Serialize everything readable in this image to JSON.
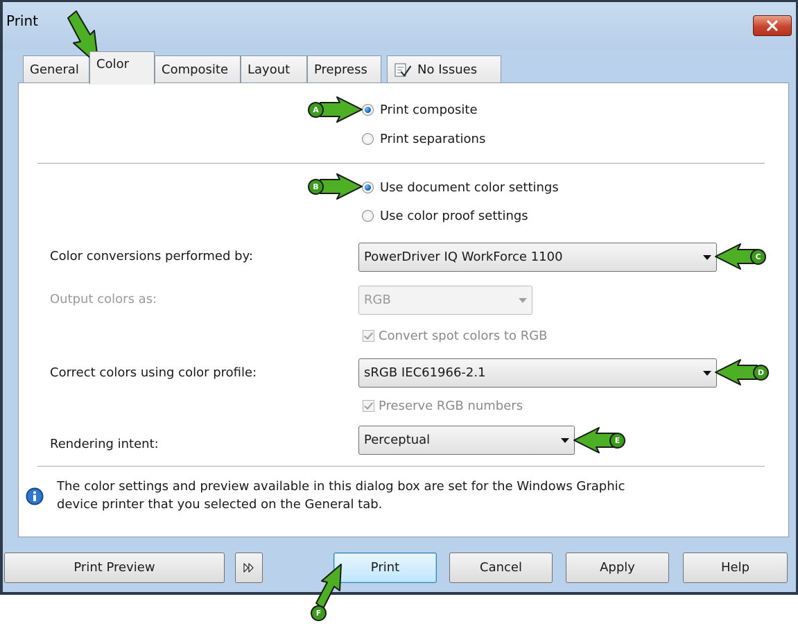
{
  "window": {
    "title": "Print"
  },
  "tabs": [
    {
      "label": "General"
    },
    {
      "label": "Color"
    },
    {
      "label": "Composite"
    },
    {
      "label": "Layout"
    },
    {
      "label": "Prepress"
    },
    {
      "label": "No Issues"
    }
  ],
  "print_mode": {
    "composite": "Print composite",
    "separations": "Print separations",
    "selected": "Print composite"
  },
  "color_source": {
    "document": "Use document color settings",
    "proof": "Use color proof settings",
    "selected": "Use document color settings"
  },
  "conversions": {
    "label": "Color conversions performed by:",
    "value": "PowerDriver IQ WorkForce 1100"
  },
  "output": {
    "label": "Output colors as:",
    "value": "RGB",
    "convert_spot": "Convert spot colors to RGB"
  },
  "profile": {
    "label": "Correct colors using color profile:",
    "value": "sRGB IEC61966-2.1",
    "preserve": "Preserve RGB numbers"
  },
  "rendering": {
    "label": "Rendering intent:",
    "value": "Perceptual"
  },
  "info": {
    "line1": "The color settings and preview available in this dialog box are set for the Windows Graphic",
    "line2": "device printer that you selected on the General tab."
  },
  "buttons": {
    "preview": "Print Preview",
    "print": "Print",
    "cancel": "Cancel",
    "apply": "Apply",
    "help": "Help"
  },
  "callouts": {
    "a": "A",
    "b": "B",
    "c": "C",
    "d": "D",
    "e": "E",
    "f": "F"
  },
  "colors": {
    "callout_green": "#3c9a1c",
    "accent_blue": "#1466b8",
    "close_red": "#c8452c"
  }
}
